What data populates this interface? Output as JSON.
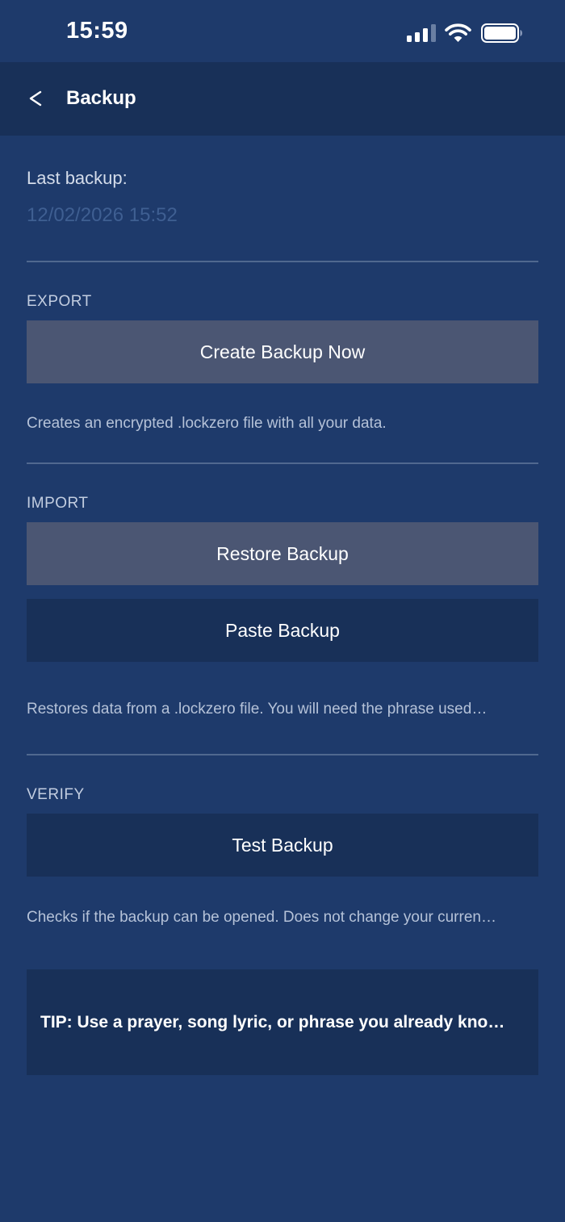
{
  "status_bar": {
    "time": "15:59",
    "icons": [
      "signal-icon",
      "wifi-icon",
      "battery-icon"
    ]
  },
  "nav": {
    "back_label": "<",
    "title": "Backup"
  },
  "last_backup": {
    "label": "Last backup:",
    "value": "12/02/2026 15:52"
  },
  "export": {
    "header": "EXPORT",
    "create_button": "Create Backup Now",
    "help": "Creates an encrypted .lockzero file with all your data."
  },
  "import": {
    "header": "IMPORT",
    "restore_button": "Restore Backup",
    "paste_button": "Paste Backup",
    "help": "Restores data from a .lockzero file. You will need the phrase used…"
  },
  "verify": {
    "header": "VERIFY",
    "test_button": "Test Backup",
    "help": "Checks if the backup can be opened. Does not change your curren…"
  },
  "tip": {
    "text": "TIP: Use a prayer, song lyric, or phrase you already kno…"
  },
  "colors": {
    "background": "#1e3a6b",
    "nav_background": "#183058",
    "button_gray": "#4b5673",
    "button_navy": "#183058",
    "muted_date": "#3f5f92"
  }
}
